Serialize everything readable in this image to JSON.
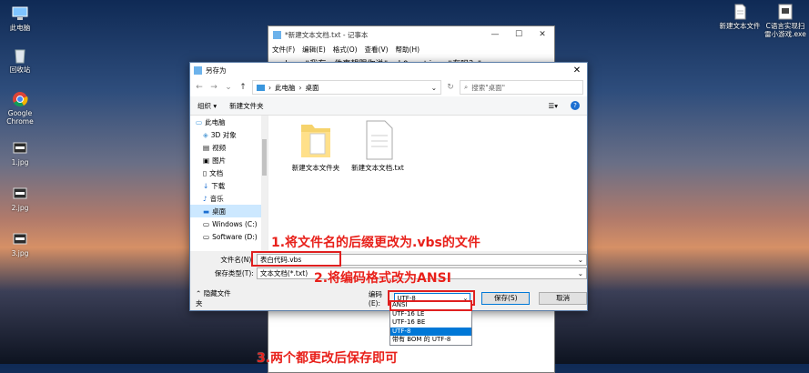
{
  "desktop": {
    "left_icons": [
      {
        "label": "此电脑",
        "icon": "computer-icon"
      },
      {
        "label": "回收站",
        "icon": "recycle-bin-icon"
      },
      {
        "label": "Google Chrome",
        "icon": "chrome-icon"
      },
      {
        "label": "1.jpg",
        "icon": "image-file-icon"
      },
      {
        "label": "2.jpg",
        "icon": "image-file-icon"
      },
      {
        "label": "3.jpg",
        "icon": "image-file-icon"
      }
    ],
    "right_icons": [
      {
        "label": "新建文本文件",
        "icon": "text-file-icon"
      },
      {
        "label": "C语言实现扫雷小游戏.exe",
        "icon": "exe-file-icon"
      }
    ]
  },
  "notepad": {
    "title": "*新建文本文档.txt - 记事本",
    "menu": [
      "文件(F)",
      "编辑(E)",
      "格式(O)",
      "查看(V)",
      "帮助(H)"
    ],
    "content": "msgbox \"我有一件事想跟你说\",vbQuestion,\"在吗？\""
  },
  "dialog": {
    "title": "另存为",
    "address": [
      "此电脑",
      "桌面"
    ],
    "search_placeholder": "搜索\"桌面\"",
    "organize_label": "组织 ▾",
    "new_folder_label": "新建文件夹",
    "nav_items": [
      "此电脑",
      "3D 对象",
      "视频",
      "图片",
      "文档",
      "下载",
      "音乐",
      "桌面",
      "Windows (C:)",
      "Software (D:)"
    ],
    "selected_nav": "桌面",
    "files": [
      {
        "name": "新建文本文件夹",
        "icon": "folder-icon"
      },
      {
        "name": "新建文本文档.txt",
        "icon": "text-file-icon"
      }
    ],
    "filename_label": "文件名(N):",
    "filename_value": "表白代码.vbs",
    "filetype_label": "保存类型(T):",
    "filetype_value": "文本文档(*.txt)",
    "hide_folders_label": "隐藏文件夹",
    "encoding_label": "编码(E):",
    "encoding_value": "UTF-8",
    "save_label": "保存(S)",
    "cancel_label": "取消"
  },
  "encoding_options": [
    "ANSI",
    "UTF-16 LE",
    "UTF-16 BE",
    "UTF-8",
    "带有 BOM 的 UTF-8"
  ],
  "encoding_highlighted": "UTF-8",
  "annotations": [
    "1.将文件名的后缀更改为.vbs的文件",
    "2.将编码格式改为ANSI",
    "3.两个都更改后保存即可"
  ],
  "colors": {
    "annotation": "#e8201a",
    "accent": "#0078d7",
    "selection": "#cce8ff"
  }
}
